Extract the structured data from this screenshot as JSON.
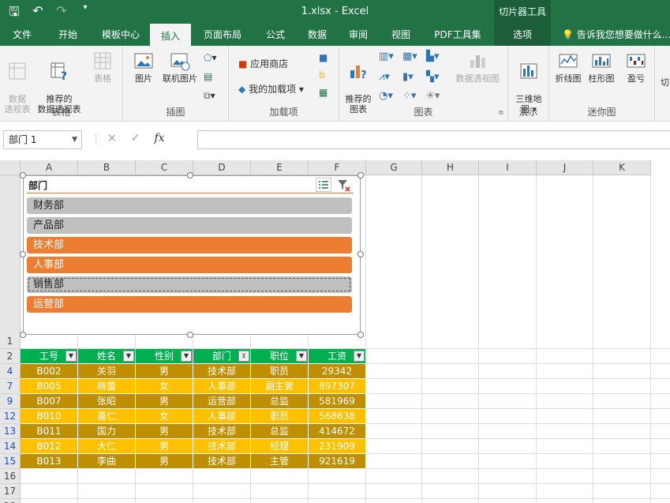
{
  "title_bar": {
    "file_title": "1.xlsx - Excel",
    "context_title": "切片器工具"
  },
  "tabs": [
    "文件",
    "开始",
    "模板中心",
    "插入",
    "页面布局",
    "公式",
    "数据",
    "审阅",
    "视图",
    "PDF工具集",
    "选项"
  ],
  "tell_me": "告诉我您想要做什么...",
  "ribbon": {
    "groups": [
      "表格",
      "插图",
      "加载项",
      "图表",
      "演示",
      "迷你图"
    ],
    "tables": [
      "数据\n透视表",
      "推荐的\n数据透视表",
      "表格"
    ],
    "illustrations": [
      "图片",
      "联机图片"
    ],
    "addins": [
      "应用商店",
      "我的加载项"
    ],
    "charts": [
      "推荐的\n图表",
      "数据透视图"
    ],
    "tour": [
      "三维地\n图 ▾"
    ],
    "sparklines": [
      "折线图",
      "柱形图",
      "盈亏"
    ],
    "more": "切"
  },
  "formula_bar": {
    "name_box": "部门 1",
    "fx": "fx",
    "cancel": "×",
    "enter": "✓"
  },
  "columns": [
    "A",
    "B",
    "C",
    "D",
    "E",
    "F",
    "G",
    "H",
    "I",
    "J",
    "K"
  ],
  "rows": [
    "1",
    "2",
    "4",
    "7",
    "9",
    "12",
    "13",
    "14",
    "15",
    "16",
    "17",
    "18"
  ],
  "slicer": {
    "title": "部门",
    "items": [
      {
        "label": "财务部",
        "selected": false
      },
      {
        "label": "产品部",
        "selected": false
      },
      {
        "label": "技术部",
        "selected": true
      },
      {
        "label": "人事部",
        "selected": true
      },
      {
        "label": "销售部",
        "selected": false,
        "focused": true
      },
      {
        "label": "运营部",
        "selected": true
      }
    ]
  },
  "table": {
    "headers": [
      "工号",
      "姓名",
      "性别",
      "部门",
      "职位",
      "工资"
    ],
    "rows": [
      [
        "B002",
        "关羽",
        "男",
        "技术部",
        "职员",
        "29342"
      ],
      [
        "B005",
        "晓蕾",
        "女",
        "人事部",
        "副主管",
        "897307"
      ],
      [
        "B007",
        "张昭",
        "男",
        "运营部",
        "总监",
        "581969"
      ],
      [
        "B010",
        "嘉仁",
        "女",
        "人事部",
        "职员",
        "568638"
      ],
      [
        "B011",
        "国力",
        "男",
        "技术部",
        "总监",
        "414672"
      ],
      [
        "B012",
        "大仁",
        "男",
        "技术部",
        "经理",
        "231909"
      ],
      [
        "B013",
        "李曲",
        "男",
        "技术部",
        "主管",
        "921619"
      ]
    ]
  },
  "colors": {
    "excel_green": "#217346",
    "header_green": "#00b050",
    "row_dark": "#bf8f00",
    "row_light": "#ffc000",
    "slicer_selected": "#ed7d31",
    "slicer_unselected": "#c0c0c0"
  }
}
